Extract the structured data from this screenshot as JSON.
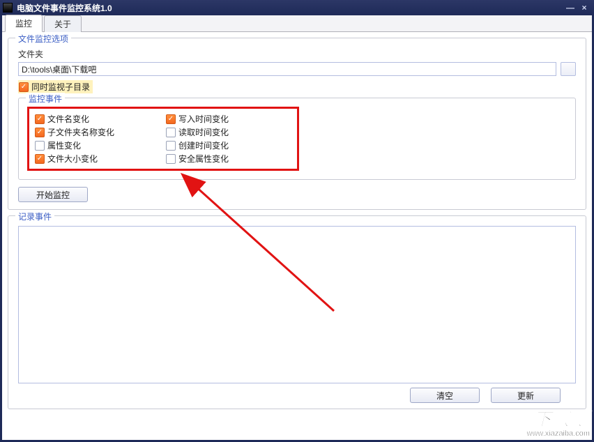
{
  "window": {
    "title": "电脑文件事件监控系统1.0",
    "minimize_glyph": "—",
    "close_glyph": "×"
  },
  "tabs": [
    {
      "label": "监控",
      "active": true
    },
    {
      "label": "关于",
      "active": false
    }
  ],
  "options_group": {
    "legend": "文件监控选项",
    "folder_label": "文件夹",
    "folder_value": "D:\\tools\\桌面\\下载吧",
    "subdir_label": "同时监视子目录",
    "subdir_checked": true
  },
  "events_group": {
    "legend": "监控事件",
    "items_col1": [
      {
        "label": "文件名变化",
        "checked": true
      },
      {
        "label": "子文件夹名称变化",
        "checked": true
      },
      {
        "label": "属性变化",
        "checked": false
      },
      {
        "label": "文件大小变化",
        "checked": true
      }
    ],
    "items_col2": [
      {
        "label": "写入时间变化",
        "checked": true
      },
      {
        "label": "读取时间变化",
        "checked": false
      },
      {
        "label": "创建时间变化",
        "checked": false
      },
      {
        "label": "安全属性变化",
        "checked": false
      }
    ]
  },
  "buttons": {
    "start": "开始监控",
    "clear": "清空",
    "refresh": "更新"
  },
  "log_group": {
    "legend": "记录事件"
  },
  "watermark": {
    "big": "下载吧",
    "small": "www.xiazaiba.com"
  },
  "colors": {
    "titlebar": "#1e2a58",
    "highlight_red": "#e11313",
    "check_accent": "#f4671f",
    "legend_blue": "#3a5dc4"
  }
}
